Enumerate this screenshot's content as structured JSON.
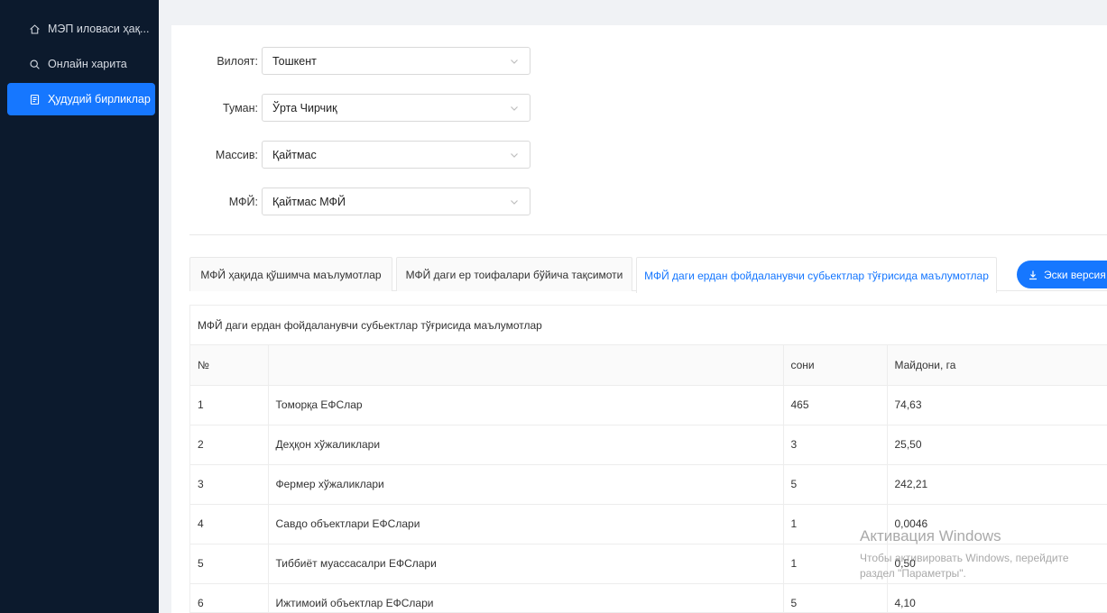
{
  "sidebar": {
    "items": [
      {
        "label": "МЭП иловаси ҳақ...",
        "icon": "home-icon",
        "active": false
      },
      {
        "label": "Онлайн харита",
        "icon": "search-icon",
        "active": false
      },
      {
        "label": "Ҳудудий бирликлар",
        "icon": "document-icon",
        "active": true
      }
    ]
  },
  "filters": {
    "region": {
      "label": "Вилоят:",
      "value": "Тошкент"
    },
    "district": {
      "label": "Туман:",
      "value": "Ўрта Чирчиқ"
    },
    "massive": {
      "label": "Массив:",
      "value": "Қайтмас"
    },
    "mfy": {
      "label": "МФЙ:",
      "value": "Қайтмас МФЙ"
    }
  },
  "tabs": [
    {
      "label": "МФЙ ҳақида қўшимча маълумотлар"
    },
    {
      "label": "МФЙ даги ер тоифалари бўйича тақсимоти"
    },
    {
      "label": "МФЙ даги ердан фойдаланувчи субьектлар тўғрисида маълумотлар"
    }
  ],
  "old_version_button": "Эски версия",
  "table": {
    "title": "МФЙ даги ердан фойдаланувчи субьектлар тўғрисида маълумотлар",
    "headers": [
      "№",
      "",
      "сони",
      "Майдони, га"
    ],
    "rows": [
      [
        "1",
        "Томорқа ЕФСлар",
        "465",
        "74,63"
      ],
      [
        "2",
        "Деҳқон хўжаликлари",
        "3",
        "25,50"
      ],
      [
        "3",
        "Фермер хўжаликлари",
        "5",
        "242,21"
      ],
      [
        "4",
        "Савдо объектлари ЕФСлари",
        "1",
        "0,0046"
      ],
      [
        "5",
        "Тиббиёт муассасалри ЕФСлари",
        "1",
        "0,50"
      ],
      [
        "6",
        "Ижтимоий объектлар ЕФСлари",
        "5",
        "4,10"
      ]
    ]
  },
  "watermark": {
    "title": "Активация Windows",
    "line1": "Чтобы активировать Windows, перейдите",
    "line2": "раздел \"Параметры\"."
  },
  "colors": {
    "sidebar": "#0c1a2d",
    "accent": "#1677ff"
  }
}
